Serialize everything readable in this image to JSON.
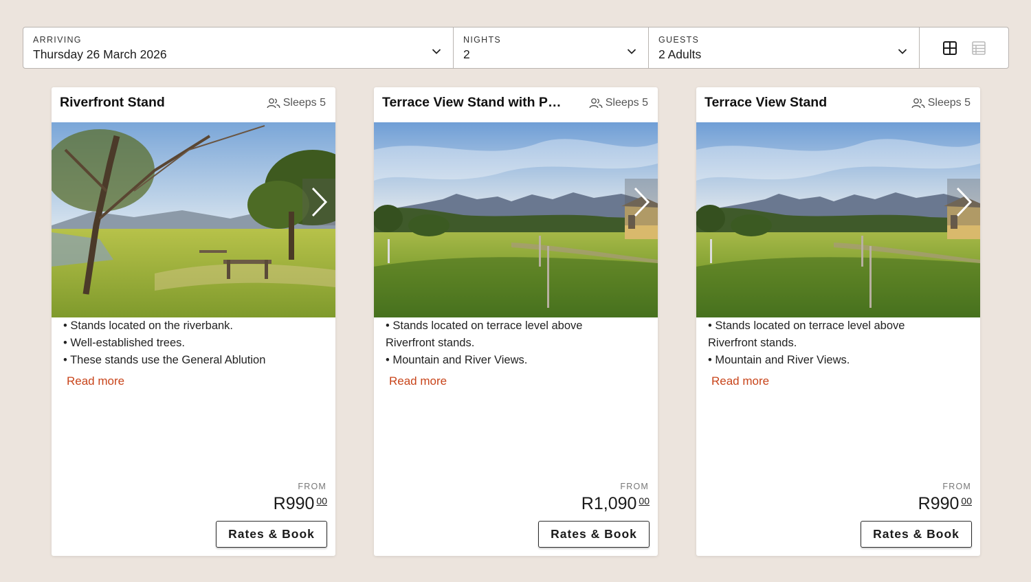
{
  "search": {
    "arriving_label": "ARRIVING",
    "arriving_value": "Thursday 26 March 2026",
    "nights_label": "NIGHTS",
    "nights_value": "2",
    "guests_label": "GUESTS",
    "guests_value": "2 Adults"
  },
  "icons": {
    "dropdown": "chevron-down-icon",
    "grid_view": "grid-view-icon",
    "list_view": "list-view-icon",
    "sleeps": "people-icon",
    "carousel_next": "chevron-right-icon"
  },
  "colors": {
    "background": "#ece4dd",
    "accent_link": "#c8441a",
    "card": "#ffffff"
  },
  "cards": [
    {
      "title": "Riverfront Stand",
      "sleeps": "Sleeps 5",
      "desc_line1": "• Stands located on the riverbank.",
      "desc_line2": "• Well-established trees.",
      "desc_line3": "• These stands use the General Ablution",
      "read_more": "Read more",
      "from_label": "FROM",
      "price": "R990",
      "price_cents": "00",
      "book_label": "Rates & Book"
    },
    {
      "title": "Terrace View Stand with Pri...",
      "sleeps": "Sleeps 5",
      "desc_line1": "• Stands located on terrace level above",
      "desc_line2": "Riverfront stands.",
      "desc_line3": "• Mountain and River Views.",
      "read_more": "Read more",
      "from_label": "FROM",
      "price": "R1,090",
      "price_cents": "00",
      "book_label": "Rates & Book"
    },
    {
      "title": "Terrace View Stand",
      "sleeps": "Sleeps 5",
      "desc_line1": "• Stands located on terrace level above",
      "desc_line2": "Riverfront stands.",
      "desc_line3": "• Mountain and River Views.",
      "read_more": "Read more",
      "from_label": "FROM",
      "price": "R990",
      "price_cents": "00",
      "book_label": "Rates & Book"
    }
  ]
}
